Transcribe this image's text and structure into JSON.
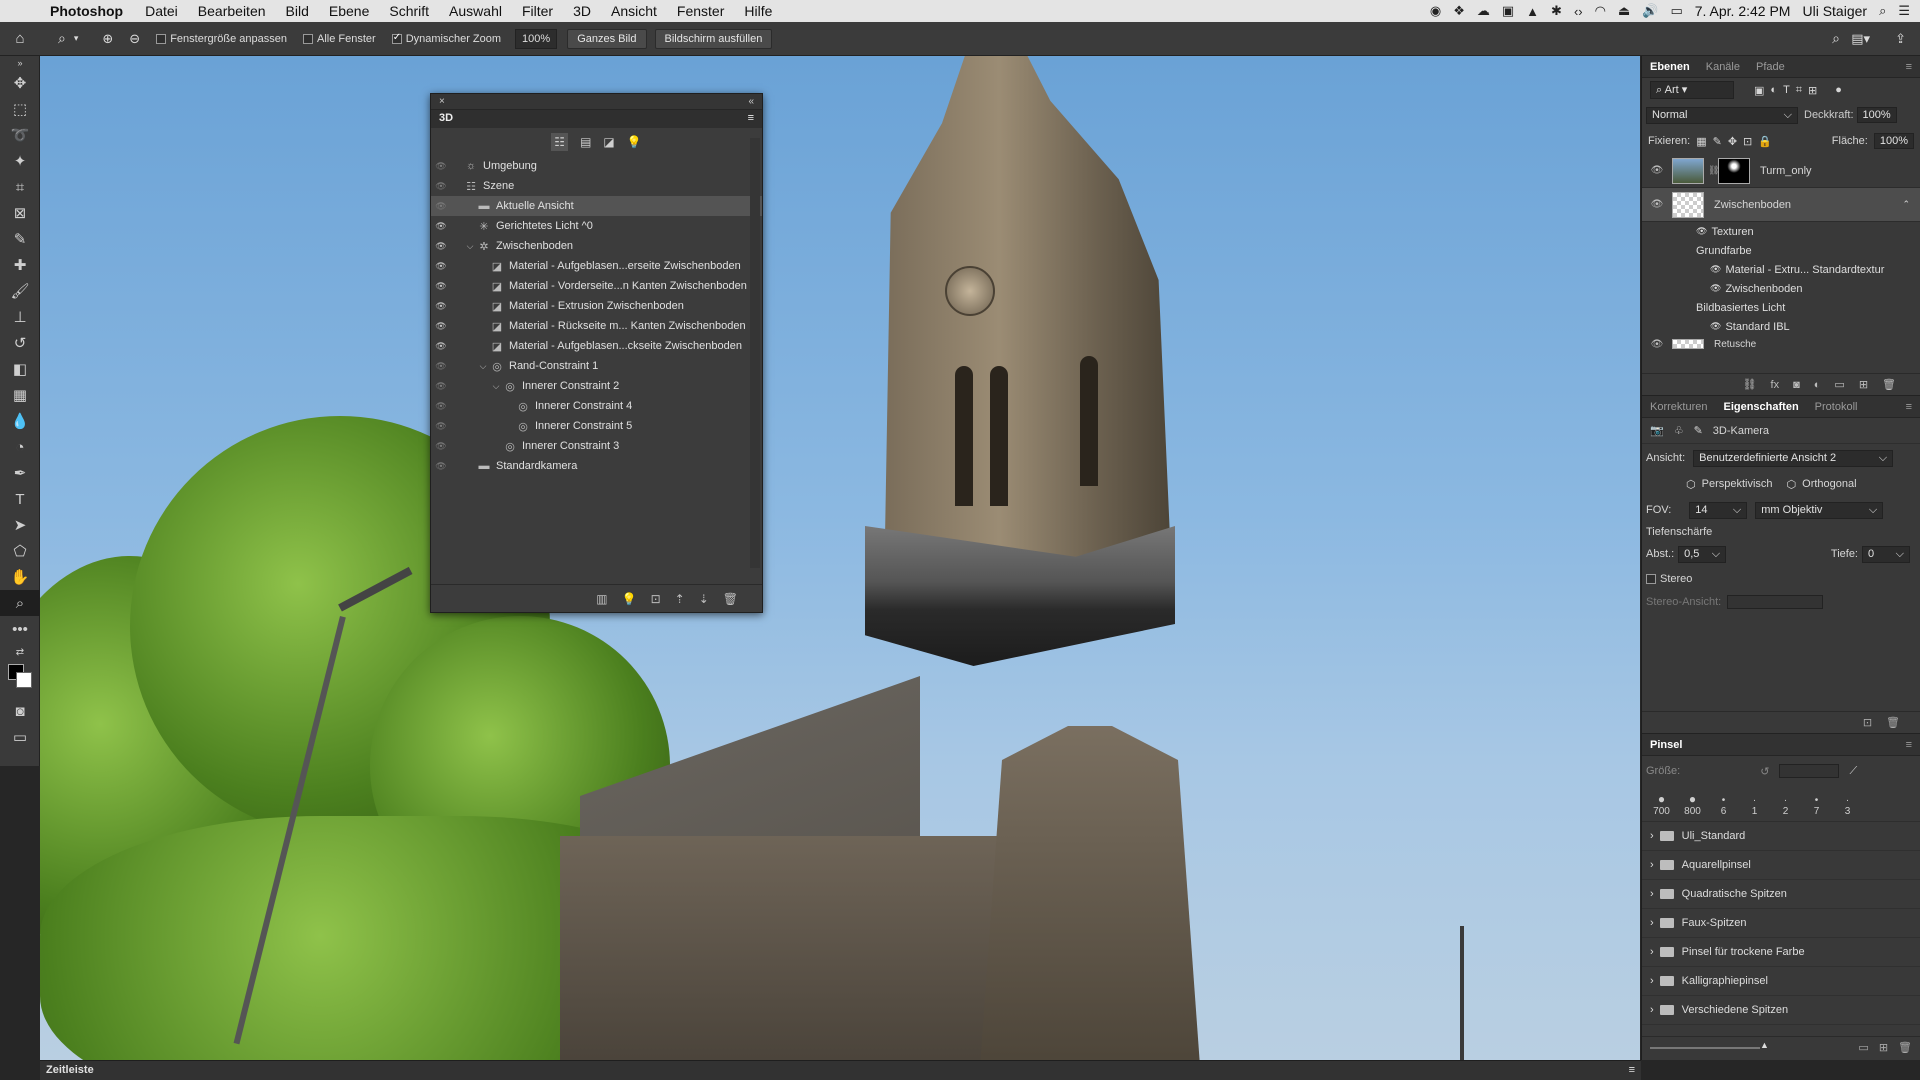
{
  "menubar": {
    "app": "Photoshop",
    "items": [
      "Datei",
      "Bearbeiten",
      "Bild",
      "Ebene",
      "Schrift",
      "Auswahl",
      "Filter",
      "3D",
      "Ansicht",
      "Fenster",
      "Hilfe"
    ],
    "datetime": "7. Apr.  2:42 PM",
    "user": "Uli Staiger"
  },
  "options": {
    "fit_window": "Fenstergröße anpassen",
    "all_windows": "Alle Fenster",
    "scrubby_zoom": "Dynamischer Zoom",
    "zoom_value": "100%",
    "fit_screen": "Ganzes Bild",
    "fill_screen": "Bildschirm ausfüllen"
  },
  "panel3d": {
    "title": "3D",
    "rows": [
      {
        "label": "Umgebung",
        "indent": 0,
        "icon": "environment-icon",
        "eye": false,
        "caret": ""
      },
      {
        "label": "Szene",
        "indent": 0,
        "icon": "scene-icon",
        "eye": false,
        "caret": ""
      },
      {
        "label": "Aktuelle Ansicht",
        "indent": 1,
        "icon": "camera-icon",
        "eye": false,
        "caret": "",
        "selected": true
      },
      {
        "label": "Gerichtetes Licht ^0",
        "indent": 1,
        "icon": "light-icon",
        "eye": true,
        "caret": ""
      },
      {
        "label": "Zwischenboden",
        "indent": 1,
        "icon": "mesh-icon",
        "eye": true,
        "caret": "⌵"
      },
      {
        "label": "Material - Aufgeblasen...erseite Zwischenboden",
        "indent": 2,
        "icon": "material-icon",
        "eye": true,
        "caret": ""
      },
      {
        "label": "Material - Vorderseite...n Kanten Zwischenboden",
        "indent": 2,
        "icon": "material-icon",
        "eye": true,
        "caret": ""
      },
      {
        "label": "Material - Extrusion Zwischenboden",
        "indent": 2,
        "icon": "material-icon",
        "eye": true,
        "caret": ""
      },
      {
        "label": "Material - Rückseite m... Kanten Zwischenboden",
        "indent": 2,
        "icon": "material-icon",
        "eye": true,
        "caret": ""
      },
      {
        "label": "Material - Aufgeblasen...ckseite Zwischenboden",
        "indent": 2,
        "icon": "material-icon",
        "eye": true,
        "caret": ""
      },
      {
        "label": "Rand-Constraint 1",
        "indent": 2,
        "icon": "constraint-icon",
        "eye": false,
        "caret": "⌵"
      },
      {
        "label": "Innerer Constraint 2",
        "indent": 3,
        "icon": "constraint-icon",
        "eye": false,
        "caret": "⌵"
      },
      {
        "label": "Innerer Constraint 4",
        "indent": 4,
        "icon": "constraint-icon",
        "eye": false,
        "caret": ""
      },
      {
        "label": "Innerer Constraint 5",
        "indent": 4,
        "icon": "constraint-icon",
        "eye": false,
        "caret": ""
      },
      {
        "label": "Innerer Constraint 3",
        "indent": 3,
        "icon": "constraint-icon",
        "eye": false,
        "caret": ""
      },
      {
        "label": "Standardkamera",
        "indent": 1,
        "icon": "camera-icon",
        "eye": false,
        "caret": ""
      }
    ]
  },
  "layers": {
    "tabs": [
      "Ebenen",
      "Kanäle",
      "Pfade"
    ],
    "filter": "Art",
    "blend": "Normal",
    "opacity_label": "Deckkraft:",
    "opacity": "100%",
    "lock_label": "Fixieren:",
    "fill_label": "Fläche:",
    "fill": "100%",
    "items": [
      {
        "name": "Turm_only"
      },
      {
        "name": "Zwischenboden",
        "selected": true
      }
    ],
    "sub": [
      {
        "label": "Texturen",
        "indent": 1,
        "eye": true
      },
      {
        "label": "Grundfarbe",
        "indent": 1,
        "eye": false
      },
      {
        "label": "Material - Extru... Standardtextur",
        "indent": 2,
        "eye": true
      },
      {
        "label": "Zwischenboden",
        "indent": 2,
        "eye": true
      },
      {
        "label": "Bildbasiertes Licht",
        "indent": 1,
        "eye": false
      },
      {
        "label": "Standard IBL",
        "indent": 2,
        "eye": true
      }
    ],
    "partial_layer": "Retusche"
  },
  "properties": {
    "tabs": [
      "Korrekturen",
      "Eigenschaften",
      "Protokoll"
    ],
    "type": "3D-Kamera",
    "view_label": "Ansicht:",
    "view": "Benutzerdefinierte Ansicht 2",
    "perspective": "Perspektivisch",
    "orthographic": "Orthogonal",
    "fov_label": "FOV:",
    "fov": "14",
    "lens": "mm Objektiv",
    "dof_label": "Tiefenschärfe",
    "dist_label": "Abst.:",
    "dist": "0,5",
    "depth_label": "Tiefe:",
    "depth": "0",
    "stereo": "Stereo",
    "stereo_view_label": "Stereo-Ansicht:"
  },
  "brush": {
    "title": "Pinsel",
    "size_label": "Größe:",
    "presets": [
      "700",
      "800",
      "6",
      "1",
      "2",
      "7",
      "3"
    ],
    "folders": [
      "Uli_Standard",
      "Aquarellpinsel",
      "Quadratische Spitzen",
      "Faux-Spitzen",
      "Pinsel für trockene Farbe",
      "Kalligraphiepinsel",
      "Verschiedene Spitzen"
    ]
  },
  "timeline": {
    "label": "Zeitleiste"
  }
}
